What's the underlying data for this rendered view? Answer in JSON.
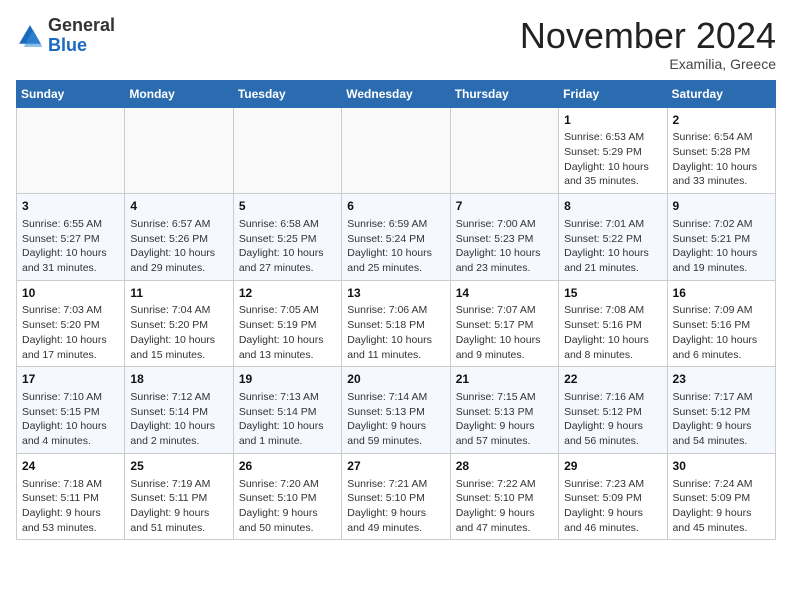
{
  "header": {
    "logo_line1": "General",
    "logo_line2": "Blue",
    "month": "November 2024",
    "location": "Examilia, Greece"
  },
  "weekdays": [
    "Sunday",
    "Monday",
    "Tuesday",
    "Wednesday",
    "Thursday",
    "Friday",
    "Saturday"
  ],
  "weeks": [
    [
      {
        "day": "",
        "info": ""
      },
      {
        "day": "",
        "info": ""
      },
      {
        "day": "",
        "info": ""
      },
      {
        "day": "",
        "info": ""
      },
      {
        "day": "",
        "info": ""
      },
      {
        "day": "1",
        "info": "Sunrise: 6:53 AM\nSunset: 5:29 PM\nDaylight: 10 hours and 35 minutes."
      },
      {
        "day": "2",
        "info": "Sunrise: 6:54 AM\nSunset: 5:28 PM\nDaylight: 10 hours and 33 minutes."
      }
    ],
    [
      {
        "day": "3",
        "info": "Sunrise: 6:55 AM\nSunset: 5:27 PM\nDaylight: 10 hours and 31 minutes."
      },
      {
        "day": "4",
        "info": "Sunrise: 6:57 AM\nSunset: 5:26 PM\nDaylight: 10 hours and 29 minutes."
      },
      {
        "day": "5",
        "info": "Sunrise: 6:58 AM\nSunset: 5:25 PM\nDaylight: 10 hours and 27 minutes."
      },
      {
        "day": "6",
        "info": "Sunrise: 6:59 AM\nSunset: 5:24 PM\nDaylight: 10 hours and 25 minutes."
      },
      {
        "day": "7",
        "info": "Sunrise: 7:00 AM\nSunset: 5:23 PM\nDaylight: 10 hours and 23 minutes."
      },
      {
        "day": "8",
        "info": "Sunrise: 7:01 AM\nSunset: 5:22 PM\nDaylight: 10 hours and 21 minutes."
      },
      {
        "day": "9",
        "info": "Sunrise: 7:02 AM\nSunset: 5:21 PM\nDaylight: 10 hours and 19 minutes."
      }
    ],
    [
      {
        "day": "10",
        "info": "Sunrise: 7:03 AM\nSunset: 5:20 PM\nDaylight: 10 hours and 17 minutes."
      },
      {
        "day": "11",
        "info": "Sunrise: 7:04 AM\nSunset: 5:20 PM\nDaylight: 10 hours and 15 minutes."
      },
      {
        "day": "12",
        "info": "Sunrise: 7:05 AM\nSunset: 5:19 PM\nDaylight: 10 hours and 13 minutes."
      },
      {
        "day": "13",
        "info": "Sunrise: 7:06 AM\nSunset: 5:18 PM\nDaylight: 10 hours and 11 minutes."
      },
      {
        "day": "14",
        "info": "Sunrise: 7:07 AM\nSunset: 5:17 PM\nDaylight: 10 hours and 9 minutes."
      },
      {
        "day": "15",
        "info": "Sunrise: 7:08 AM\nSunset: 5:16 PM\nDaylight: 10 hours and 8 minutes."
      },
      {
        "day": "16",
        "info": "Sunrise: 7:09 AM\nSunset: 5:16 PM\nDaylight: 10 hours and 6 minutes."
      }
    ],
    [
      {
        "day": "17",
        "info": "Sunrise: 7:10 AM\nSunset: 5:15 PM\nDaylight: 10 hours and 4 minutes."
      },
      {
        "day": "18",
        "info": "Sunrise: 7:12 AM\nSunset: 5:14 PM\nDaylight: 10 hours and 2 minutes."
      },
      {
        "day": "19",
        "info": "Sunrise: 7:13 AM\nSunset: 5:14 PM\nDaylight: 10 hours and 1 minute."
      },
      {
        "day": "20",
        "info": "Sunrise: 7:14 AM\nSunset: 5:13 PM\nDaylight: 9 hours and 59 minutes."
      },
      {
        "day": "21",
        "info": "Sunrise: 7:15 AM\nSunset: 5:13 PM\nDaylight: 9 hours and 57 minutes."
      },
      {
        "day": "22",
        "info": "Sunrise: 7:16 AM\nSunset: 5:12 PM\nDaylight: 9 hours and 56 minutes."
      },
      {
        "day": "23",
        "info": "Sunrise: 7:17 AM\nSunset: 5:12 PM\nDaylight: 9 hours and 54 minutes."
      }
    ],
    [
      {
        "day": "24",
        "info": "Sunrise: 7:18 AM\nSunset: 5:11 PM\nDaylight: 9 hours and 53 minutes."
      },
      {
        "day": "25",
        "info": "Sunrise: 7:19 AM\nSunset: 5:11 PM\nDaylight: 9 hours and 51 minutes."
      },
      {
        "day": "26",
        "info": "Sunrise: 7:20 AM\nSunset: 5:10 PM\nDaylight: 9 hours and 50 minutes."
      },
      {
        "day": "27",
        "info": "Sunrise: 7:21 AM\nSunset: 5:10 PM\nDaylight: 9 hours and 49 minutes."
      },
      {
        "day": "28",
        "info": "Sunrise: 7:22 AM\nSunset: 5:10 PM\nDaylight: 9 hours and 47 minutes."
      },
      {
        "day": "29",
        "info": "Sunrise: 7:23 AM\nSunset: 5:09 PM\nDaylight: 9 hours and 46 minutes."
      },
      {
        "day": "30",
        "info": "Sunrise: 7:24 AM\nSunset: 5:09 PM\nDaylight: 9 hours and 45 minutes."
      }
    ]
  ]
}
